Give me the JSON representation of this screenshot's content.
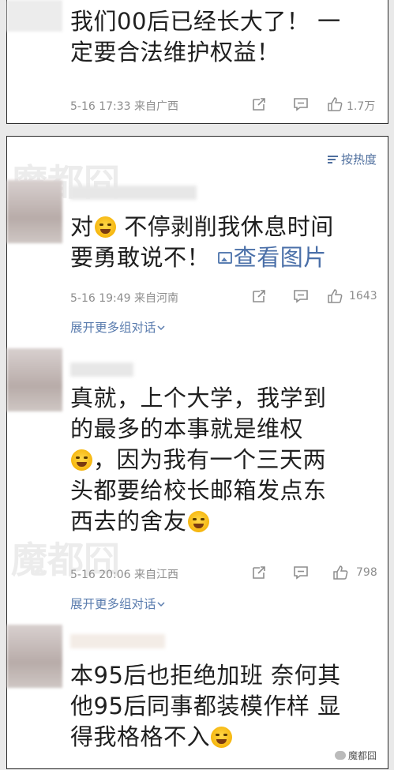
{
  "comments": [
    {
      "text_lines": [
        "我们00后已经长大了！ 一",
        "定要合法维护权益！"
      ],
      "time": "5-16 17:33",
      "location": "来自广西",
      "likes": "1.7万"
    },
    {
      "text_pre": "对",
      "text_post": " 不停剥削我休息时间",
      "text_line2": "要勇敢说不！",
      "image_link": "查看图片",
      "time": "5-16 19:49",
      "location": "来自河南",
      "likes": "1643",
      "expand": "展开更多组对话"
    },
    {
      "text_lines": [
        "真就，上个大学，我学到",
        "的最多的本事就是维权"
      ],
      "text_line3_post": "，因为我有一个三天两",
      "text_line4": "头都要给校长邮箱发点东",
      "text_line5": "西去的舍友",
      "time": "5-16 20:06",
      "location": "来自江西",
      "likes": "798",
      "expand": "展开更多组对话"
    },
    {
      "text_lines": [
        "本95后也拒绝加班 奈何其",
        "他95后同事都装模作样 显"
      ],
      "text_line3": "得我格格不入"
    }
  ],
  "sort_label": "按热度",
  "watermark": "魔都囧",
  "colors": {
    "link": "#4a6fa8",
    "meta": "#8e8e8e",
    "text": "#1f1f1f"
  },
  "icons": [
    "share-icon",
    "comment-icon",
    "like-icon",
    "image-icon",
    "chevron-down-icon",
    "sort-icon",
    "emoji-icon"
  ]
}
